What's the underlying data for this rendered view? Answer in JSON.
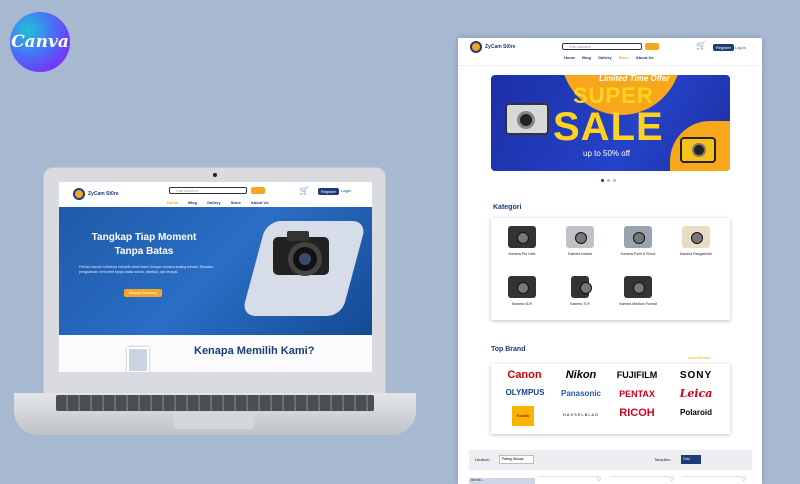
{
  "canva": {
    "logo_text": "Canva"
  },
  "laptop_site": {
    "brand": "ZyCam St0re",
    "search_placeholder": "Cari kamera",
    "cart_icon": "cart-icon",
    "register": "Register",
    "login": "Login",
    "menu": [
      "Home",
      "Blog",
      "Gallery",
      "Store",
      "About Us"
    ],
    "active_menu": "Home",
    "hero_title": "Tangkap Tiap Moment Tanpa Batas",
    "hero_desc": "Pelihat momen istimewa menarik dihari kamu dengan kamera analog terbaik. Rasakan pengalaman memotret tanpa batas warna, estetika, dan tempat.",
    "hero_button": "Belanja Sekarang",
    "section_title": "Kenapa Memilih Kami?"
  },
  "web_page": {
    "brand": "ZyCam St0re",
    "search_placeholder": "Cari kamera",
    "register": "Register",
    "login": "Log in",
    "menu": [
      "Home",
      "Blog",
      "Gallery",
      "Store",
      "About Us"
    ],
    "active_menu": "Store",
    "banner": {
      "limited": "Limited Time Offer",
      "super": "SUPER",
      "sale": "SALE",
      "discount": "up to 50% off"
    },
    "kategori_title": "Kategori",
    "kategori": [
      "Kamera Pro Hobi",
      "Kamera Instant",
      "Kamera Point & Shoot",
      "Kamera Rangefinder",
      "Kamera SLR",
      "Kamera TLR",
      "Kamera Medium Format"
    ],
    "brand_title": "Top Brand",
    "lihat_semua": "Lihat Semua",
    "brands": [
      "Canon",
      "Nikon",
      "FUJIFILM",
      "SONY",
      "OLYMPUS",
      "Panasonic",
      "PENTAX",
      "Leica",
      "Kodak",
      "HASSELBLAD",
      "RICOH",
      "Polaroid"
    ],
    "urutkan_label": "Urutkan :",
    "urutkan_value": "Paling Sesuai",
    "tampilan_label": "Tampilan :",
    "tampilan_value": "Grid",
    "filter_title": "Berdik..."
  },
  "colors": {
    "navy": "#1a3c7a",
    "orange": "#f5a623",
    "background": "#a7b8d1"
  }
}
